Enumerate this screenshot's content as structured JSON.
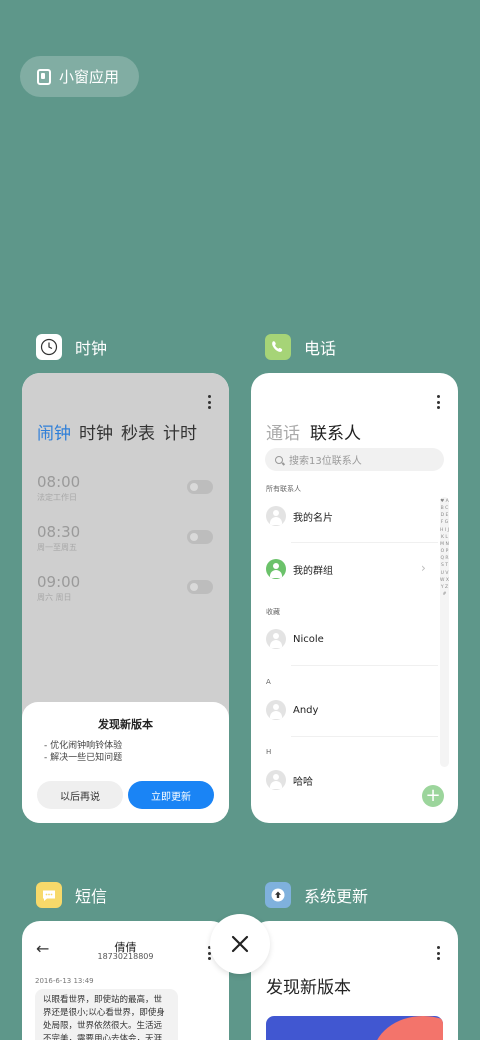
{
  "floating_pill": {
    "label": "小窗应用"
  },
  "apps": {
    "clock": {
      "name": "时钟",
      "tabs": [
        "闹钟",
        "时钟",
        "秒表",
        "计时"
      ],
      "alarms": [
        {
          "time": "08:00",
          "repeat": "法定工作日"
        },
        {
          "time": "08:30",
          "repeat": "周一至周五"
        },
        {
          "time": "09:00",
          "repeat": "周六 周日"
        }
      ],
      "dialog": {
        "title": "发现新版本",
        "lines": [
          "- 优化闹钟响铃体验",
          "- 解决一些已知问题"
        ],
        "later": "以后再说",
        "update": "立即更新"
      }
    },
    "phone": {
      "name": "电话",
      "tabs": [
        "通话",
        "联系人"
      ],
      "search_placeholder": "搜索13位联系人",
      "sections": {
        "all": "所有联系人",
        "fav": "收藏",
        "a": "A",
        "h": "H"
      },
      "rows": {
        "card": "我的名片",
        "groups": "我的群组",
        "nicole": "Nicole",
        "andy": "Andy",
        "haha": "哈哈"
      },
      "index_letters": "♥ A B C D E F G H I J K L M N O P Q R S T U V W X Y Z #"
    },
    "sms": {
      "name": "短信",
      "contact_name": "倩倩",
      "contact_number": "18730218809",
      "date": "2016-6-13 13:49",
      "message": "以眼看世界，即使站的最高，世界还是很小;以心看世界，即使身处局限，世界依然很大。生活远不完美，需要用心去体会，天涯只在一"
    },
    "update": {
      "name": "系统更新",
      "title": "发现新版本"
    }
  },
  "colors": {
    "background": "#5e978a",
    "accent": "#1a84f5",
    "clock_tab_active": "#2f7fd8",
    "phone_icon": "#a6d477",
    "sms_icon": "#f7d96a",
    "update_icon": "#7fb1dd"
  }
}
